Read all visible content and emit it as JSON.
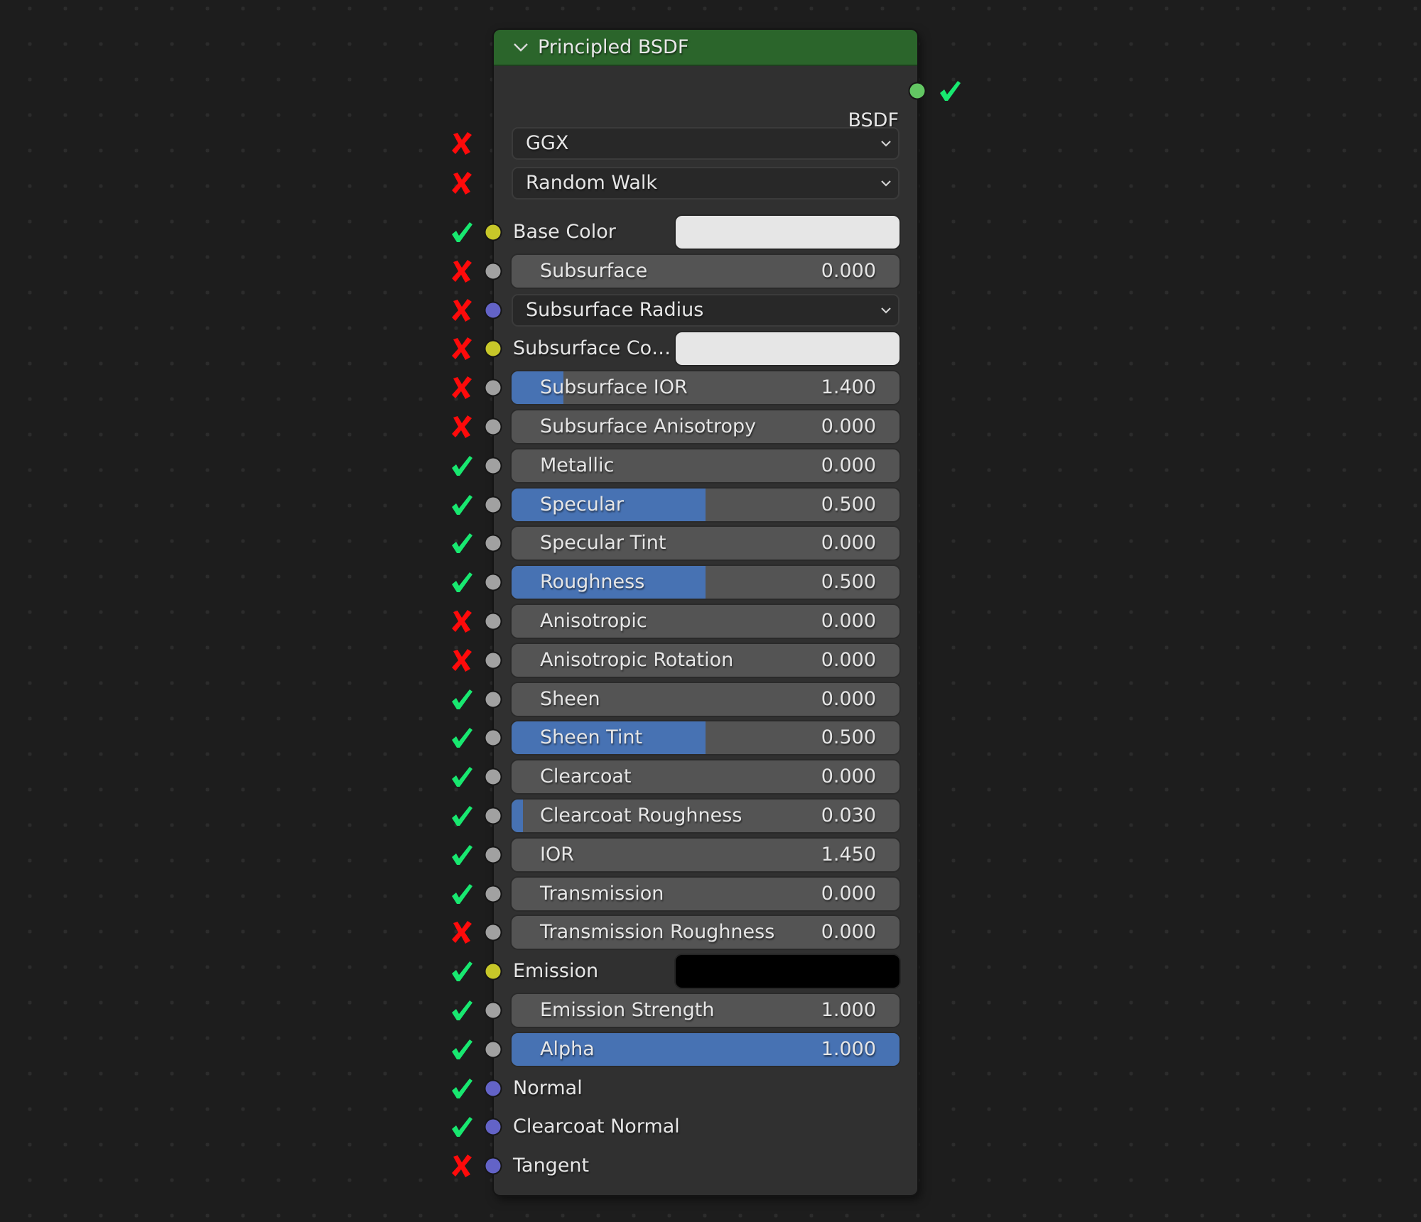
{
  "node": {
    "title": "Principled BSDF",
    "header_color": "#2b652b",
    "collapse_icon": "chevron-down-icon",
    "output": {
      "label": "BSDF",
      "socket_color": "#63c763",
      "status": "check"
    }
  },
  "status_colors": {
    "check": "#18e870",
    "cross": "#ff0a0a"
  },
  "socket_colors": {
    "color": "#c7c729",
    "float": "#a1a1a1",
    "vector": "#6363c7"
  },
  "rows": [
    {
      "kind": "dropdown",
      "label": "GGX",
      "status": "cross"
    },
    {
      "kind": "dropdown",
      "label": "Random Walk",
      "status": "cross"
    },
    {
      "kind": "color",
      "label": "Base Color",
      "socket": "color",
      "color": "#e6e6e6",
      "status": "check"
    },
    {
      "kind": "slider",
      "label": "Subsurface",
      "value": "0.000",
      "fill": 0,
      "socket": "float",
      "status": "cross"
    },
    {
      "kind": "dropdown",
      "label": "Subsurface Radius",
      "socket": "vector",
      "status": "cross"
    },
    {
      "kind": "color",
      "label": "Subsurface Co…",
      "socket": "color",
      "color": "#e6e6e6",
      "status": "cross"
    },
    {
      "kind": "slider",
      "label": "Subsurface IOR",
      "value": "1.400",
      "fill": 0.133,
      "socket": "float",
      "status": "cross"
    },
    {
      "kind": "slider",
      "label": "Subsurface Anisotropy",
      "value": "0.000",
      "fill": 0,
      "socket": "float",
      "status": "cross"
    },
    {
      "kind": "slider",
      "label": "Metallic",
      "value": "0.000",
      "fill": 0,
      "socket": "float",
      "status": "check"
    },
    {
      "kind": "slider",
      "label": "Specular",
      "value": "0.500",
      "fill": 0.5,
      "socket": "float",
      "status": "check"
    },
    {
      "kind": "slider",
      "label": "Specular Tint",
      "value": "0.000",
      "fill": 0,
      "socket": "float",
      "status": "check"
    },
    {
      "kind": "slider",
      "label": "Roughness",
      "value": "0.500",
      "fill": 0.5,
      "socket": "float",
      "status": "check"
    },
    {
      "kind": "slider",
      "label": "Anisotropic",
      "value": "0.000",
      "fill": 0,
      "socket": "float",
      "status": "cross"
    },
    {
      "kind": "slider",
      "label": "Anisotropic Rotation",
      "value": "0.000",
      "fill": 0,
      "socket": "float",
      "status": "cross"
    },
    {
      "kind": "slider",
      "label": "Sheen",
      "value": "0.000",
      "fill": 0,
      "socket": "float",
      "status": "check"
    },
    {
      "kind": "slider",
      "label": "Sheen Tint",
      "value": "0.500",
      "fill": 0.5,
      "socket": "float",
      "status": "check"
    },
    {
      "kind": "slider",
      "label": "Clearcoat",
      "value": "0.000",
      "fill": 0,
      "socket": "float",
      "status": "check"
    },
    {
      "kind": "slider",
      "label": "Clearcoat Roughness",
      "value": "0.030",
      "fill": 0.03,
      "socket": "float",
      "status": "check"
    },
    {
      "kind": "slider",
      "label": "IOR",
      "value": "1.450",
      "fill": 0,
      "socket": "float",
      "status": "check"
    },
    {
      "kind": "slider",
      "label": "Transmission",
      "value": "0.000",
      "fill": 0,
      "socket": "float",
      "status": "check"
    },
    {
      "kind": "slider",
      "label": "Transmission Roughness",
      "value": "0.000",
      "fill": 0,
      "socket": "float",
      "status": "cross"
    },
    {
      "kind": "color",
      "label": "Emission",
      "socket": "color",
      "color": "#000000",
      "status": "check"
    },
    {
      "kind": "slider",
      "label": "Emission Strength",
      "value": "1.000",
      "fill": 0,
      "socket": "float",
      "status": "check"
    },
    {
      "kind": "slider",
      "label": "Alpha",
      "value": "1.000",
      "fill": 1,
      "socket": "float",
      "status": "check"
    },
    {
      "kind": "socket",
      "label": "Normal",
      "socket": "vector",
      "status": "check"
    },
    {
      "kind": "socket",
      "label": "Clearcoat Normal",
      "socket": "vector",
      "status": "check"
    },
    {
      "kind": "socket",
      "label": "Tangent",
      "socket": "vector",
      "status": "cross"
    }
  ]
}
